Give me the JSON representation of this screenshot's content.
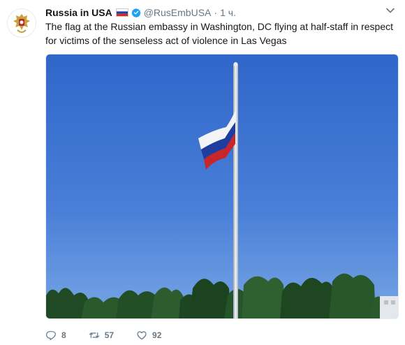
{
  "tweet": {
    "author_name": "Russia in USA",
    "author_flag": "russia-flag-icon",
    "verified": true,
    "handle": "@RusEmbUSA",
    "separator": "·",
    "time": "1 ч.",
    "text": "The flag at the Russian embassy in Washington, DC flying at half-staff in respect for victims of the senseless act of violence in Las Vegas",
    "actions": {
      "reply_count": "8",
      "retweet_count": "57",
      "like_count": "92"
    }
  },
  "colors": {
    "accent": "#1da1f2",
    "secondary_text": "#657786",
    "sky": "#3f78d4"
  }
}
